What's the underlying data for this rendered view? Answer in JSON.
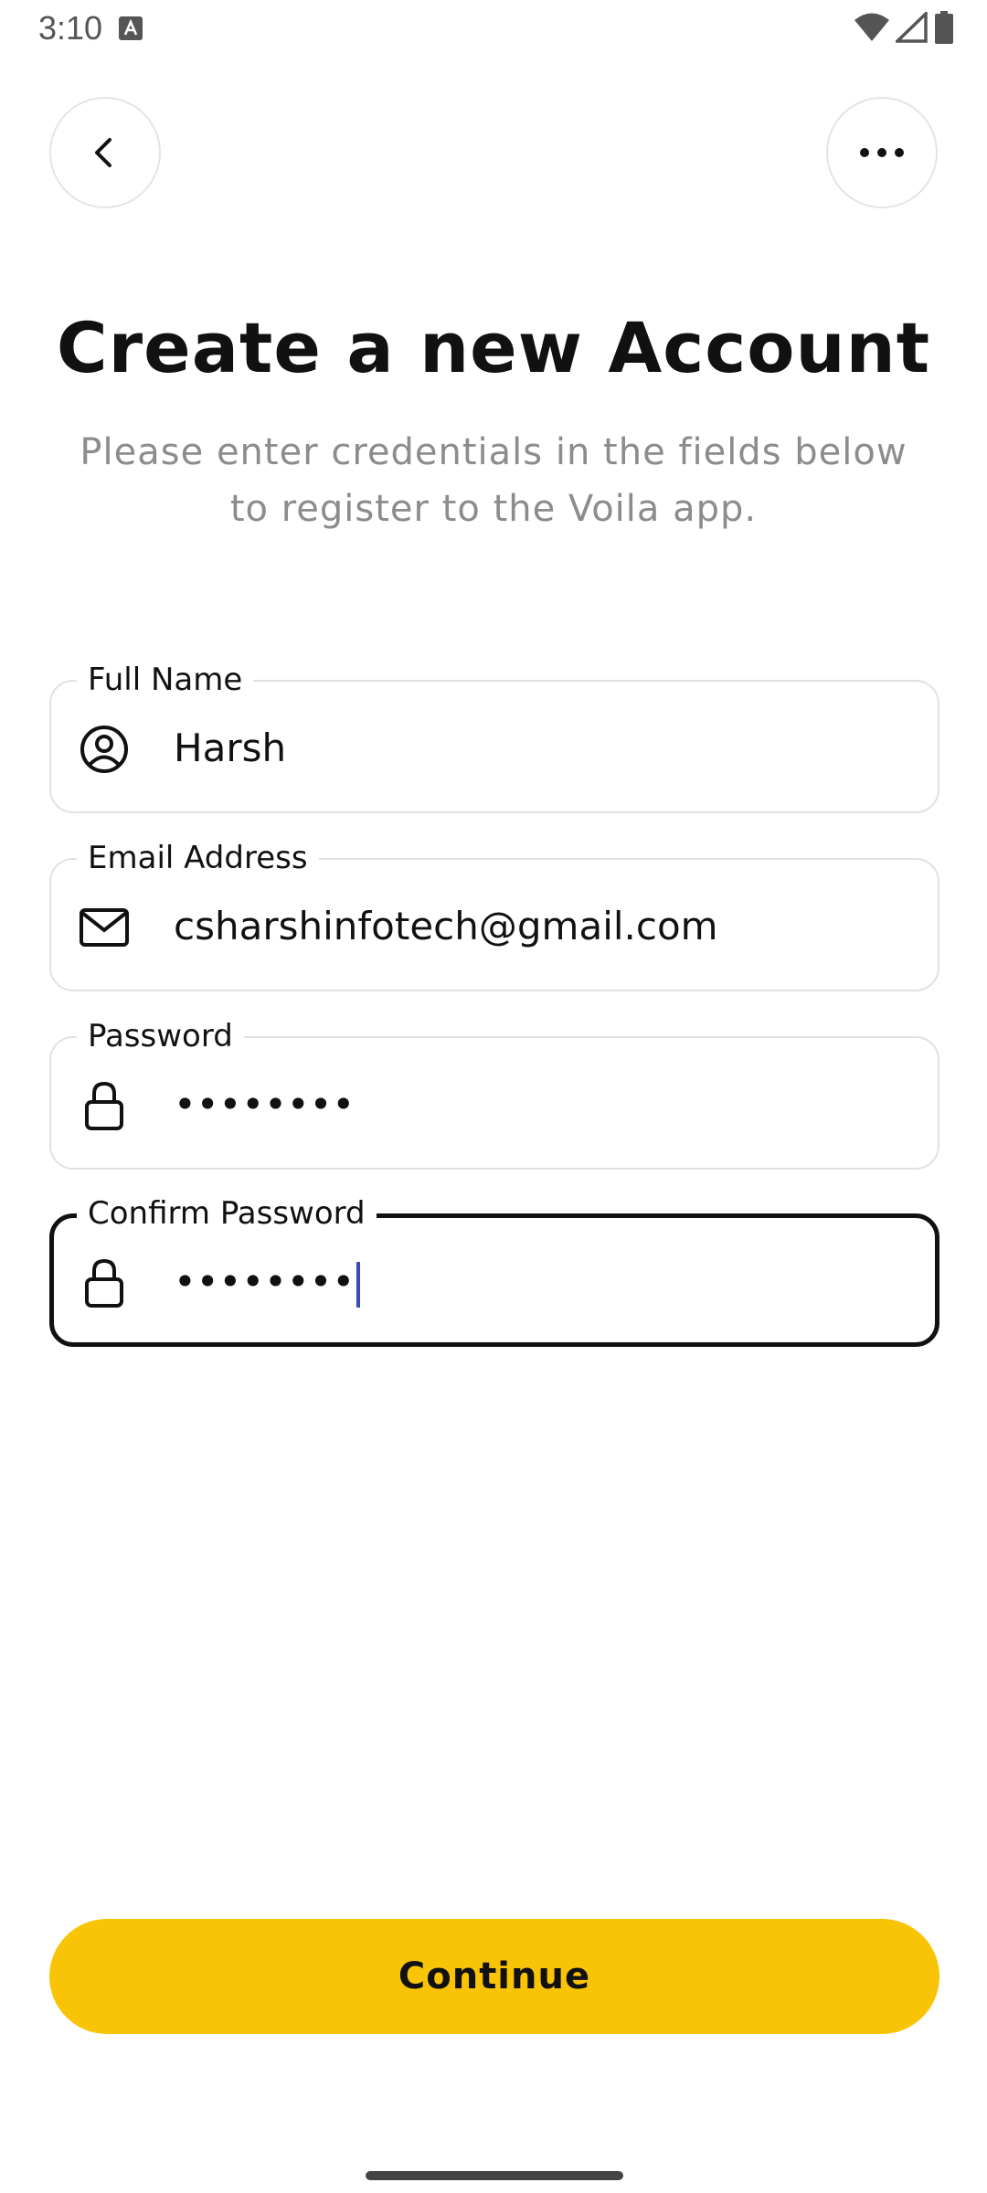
{
  "status_bar": {
    "time": "3:10",
    "icons": [
      "a-notification-icon",
      "wifi-icon",
      "signal-icon",
      "battery-icon"
    ]
  },
  "header": {
    "back_icon": "chevron-left-icon",
    "more_icon": "more-horizontal-icon"
  },
  "title": "Create a new Account",
  "subtitle_line1": "Please enter credentials in the fields below",
  "subtitle_line2": "to register to the Voila app.",
  "form": {
    "full_name": {
      "label": "Full Name",
      "value": "Harsh",
      "icon": "user-circle-icon"
    },
    "email": {
      "label": "Email Address",
      "value": "csharshinfotech@gmail.com",
      "icon": "mail-icon"
    },
    "password": {
      "label": "Password",
      "value": "••••••••",
      "icon": "lock-icon"
    },
    "confirm_password": {
      "label": "Confirm Password",
      "value": "••••••••",
      "icon": "lock-icon"
    }
  },
  "continue_label": "Continue",
  "colors": {
    "accent": "#f9c406",
    "caret": "#3b4cb8",
    "border": "#e1e1e1",
    "subtitle": "#8c8c8c"
  }
}
